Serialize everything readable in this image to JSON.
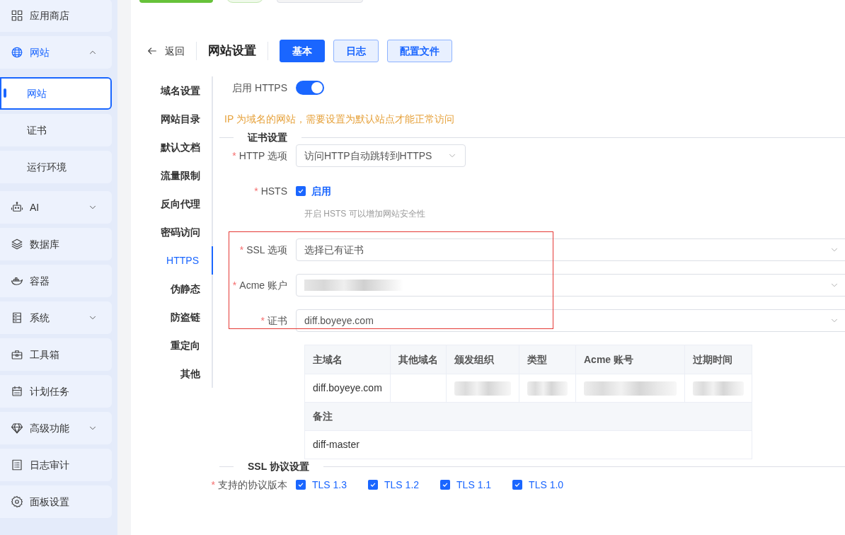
{
  "sidebar": {
    "items": [
      {
        "label": "应用商店"
      },
      {
        "label": "网站",
        "expanded": true,
        "selected": true,
        "children": [
          {
            "label": "网站",
            "selected": true
          },
          {
            "label": "证书",
            "selected": false
          },
          {
            "label": "运行环境",
            "selected": false
          }
        ]
      },
      {
        "label": "AI",
        "expanded": false
      },
      {
        "label": "数据库"
      },
      {
        "label": "容器"
      },
      {
        "label": "系统",
        "expanded": false
      },
      {
        "label": "工具箱"
      },
      {
        "label": "计划任务"
      },
      {
        "label": "高级功能",
        "expanded": false
      },
      {
        "label": "日志审计"
      },
      {
        "label": "面板设置"
      }
    ]
  },
  "header": {
    "back": "返回",
    "title": "网站设置",
    "tabs": [
      {
        "label": "基本",
        "selected": true
      },
      {
        "label": "日志",
        "selected": false
      },
      {
        "label": "配置文件",
        "selected": false
      }
    ]
  },
  "settings_nav": [
    {
      "label": "域名设置",
      "selected": false
    },
    {
      "label": "网站目录",
      "selected": false
    },
    {
      "label": "默认文档",
      "selected": false
    },
    {
      "label": "流量限制",
      "selected": false
    },
    {
      "label": "反向代理",
      "selected": false
    },
    {
      "label": "密码访问",
      "selected": false
    },
    {
      "label": "HTTPS",
      "selected": true
    },
    {
      "label": "伪静态",
      "selected": false
    },
    {
      "label": "防盗链",
      "selected": false
    },
    {
      "label": "重定向",
      "selected": false
    },
    {
      "label": "其他",
      "selected": false
    }
  ],
  "https_toggle": {
    "label": "启用 HTTPS",
    "on": true
  },
  "warning": "IP 为域名的网站，需要设置为默认站点才能正常访问",
  "cert_section": {
    "title": "证书设置"
  },
  "http_option": {
    "label": "HTTP 选项",
    "required_mark": "*",
    "value": "访问HTTP自动跳转到HTTPS"
  },
  "hsts": {
    "label": "HSTS",
    "required_mark": "*",
    "option": "启用",
    "checked": true,
    "hint": "开启 HSTS 可以增加网站安全性"
  },
  "highlight_frame": true,
  "cert_fields": [
    {
      "label": "SSL 选项",
      "required_mark": "*",
      "value": "选择已有证书",
      "redacted": false
    },
    {
      "label": "Acme 账户",
      "required_mark": "*",
      "redacted": true
    },
    {
      "label": "证书",
      "required_mark": "*",
      "value": "diff.boyeye.com",
      "redacted": false
    }
  ],
  "cert_table": {
    "columns": [
      "主域名",
      "其他域名",
      "颁发组织",
      "类型",
      "Acme 账号",
      "过期时间"
    ],
    "row": [
      {
        "kind": "text",
        "text": "diff.boyeye.com"
      },
      {
        "kind": "empty"
      },
      {
        "kind": "redacted"
      },
      {
        "kind": "redacted"
      },
      {
        "kind": "redacted"
      },
      {
        "kind": "redacted"
      }
    ],
    "note_label": "备注",
    "note": "diff-master"
  },
  "protocol_section": {
    "title": "SSL 协议设置"
  },
  "protocols": {
    "label": "支持的协议版本",
    "required_mark": "*",
    "options": [
      {
        "label": "TLS 1.3",
        "checked": true
      },
      {
        "label": "TLS 1.2",
        "checked": true
      },
      {
        "label": "TLS 1.1",
        "checked": true
      },
      {
        "label": "TLS 1.0",
        "checked": true
      }
    ]
  }
}
